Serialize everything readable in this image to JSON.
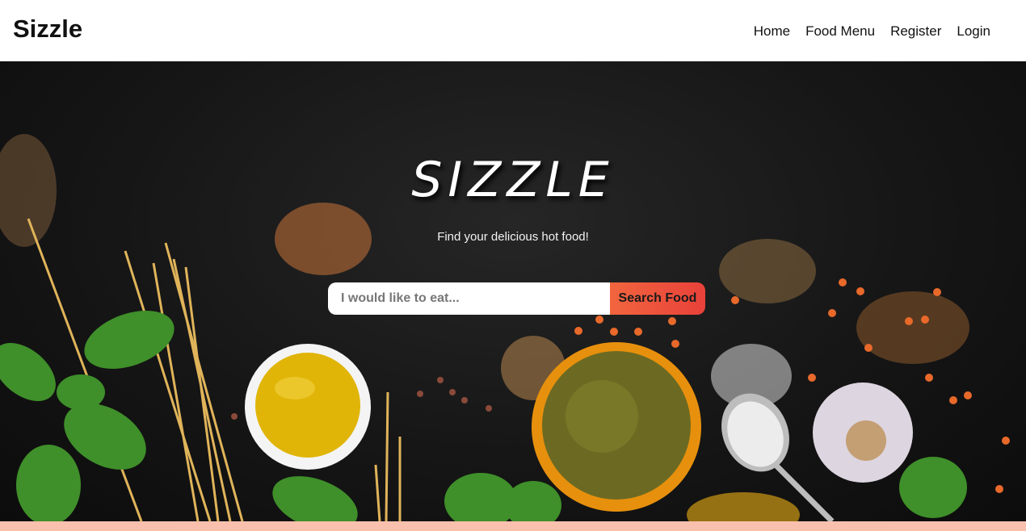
{
  "header": {
    "brand": "Sizzle",
    "nav": [
      "Home",
      "Food Menu",
      "Register",
      "Login"
    ]
  },
  "hero": {
    "title": "SIZZLE",
    "subtitle": "Find your delicious hot food!",
    "search_placeholder": "I would like to eat...",
    "search_button": "Search Food"
  },
  "colors": {
    "accent": "#ef5a3c",
    "footer_strip": "#f9c0ae"
  }
}
